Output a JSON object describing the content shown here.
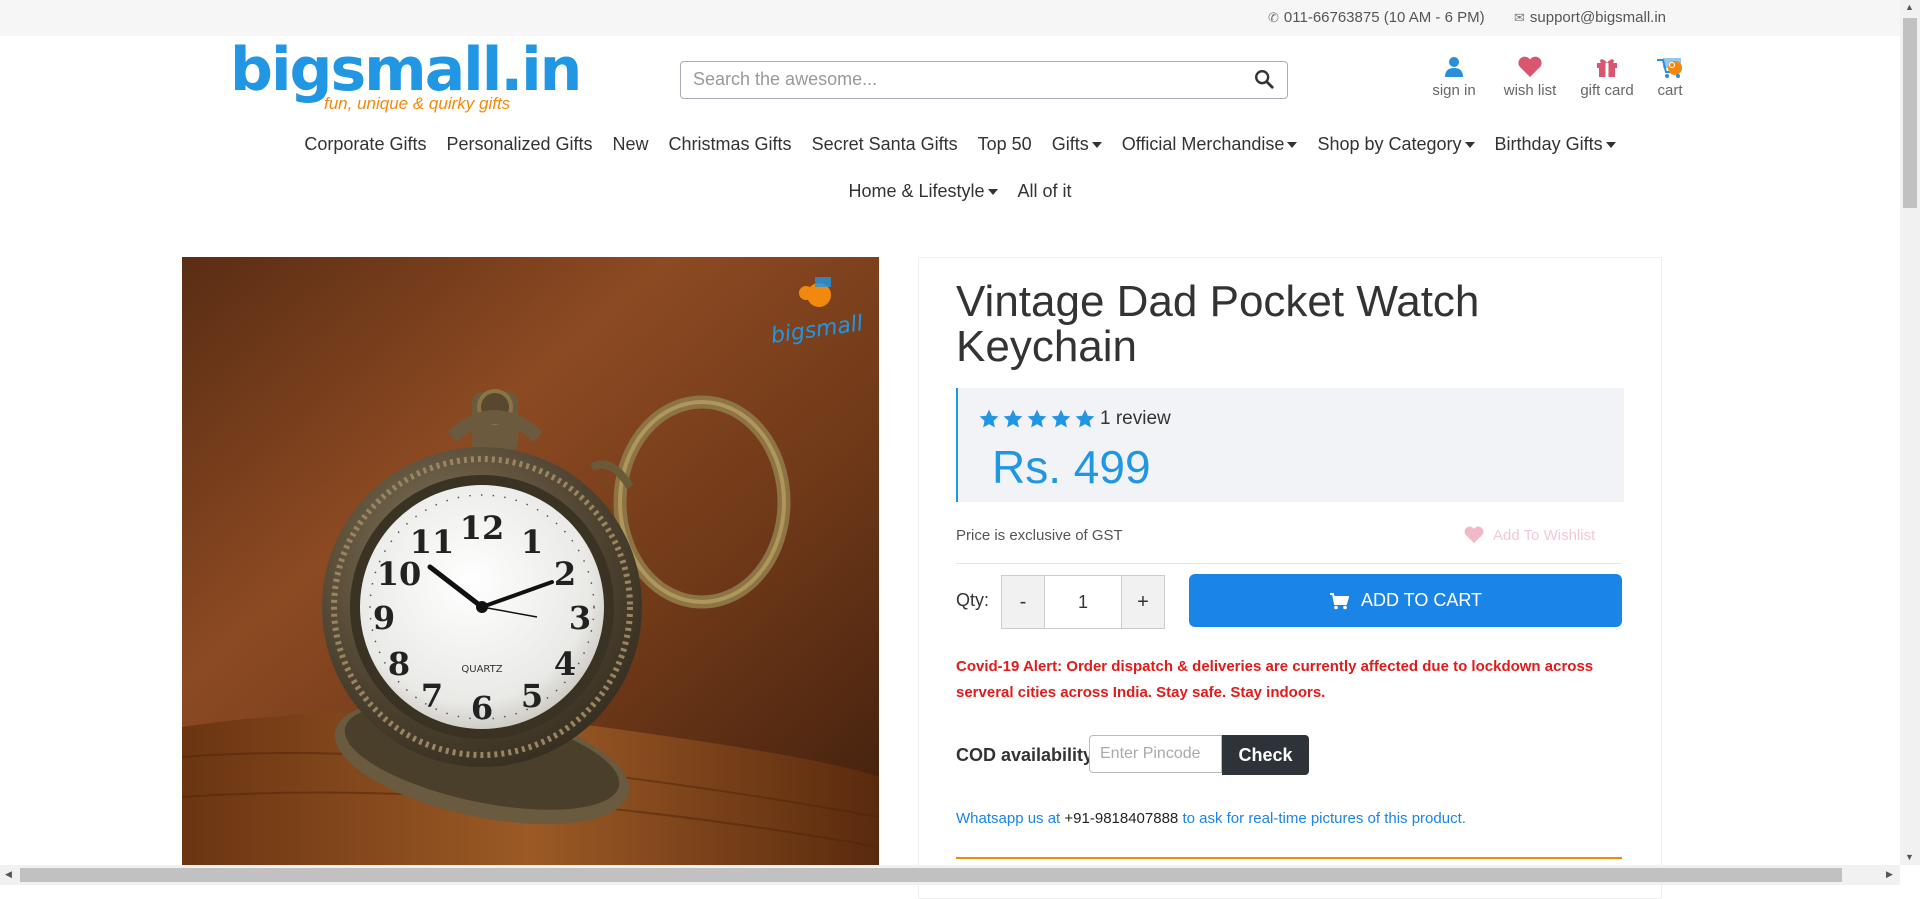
{
  "topbar": {
    "phone": "011-66763875 (10 AM - 6 PM)",
    "email": "support@bigsmall.in"
  },
  "logo": {
    "brand": "bigsmall.in",
    "tagline": "fun, unique & quirky gifts"
  },
  "search": {
    "placeholder": "Search the awesome..."
  },
  "header_icons": {
    "signin": "sign in",
    "wishlist": "wish list",
    "giftcard": "gift card",
    "cart": "cart"
  },
  "nav": {
    "row1": [
      {
        "label": "Corporate Gifts",
        "dropdown": false
      },
      {
        "label": "Personalized Gifts",
        "dropdown": false
      },
      {
        "label": "New",
        "dropdown": false
      },
      {
        "label": "Christmas Gifts",
        "dropdown": false
      },
      {
        "label": "Secret Santa Gifts",
        "dropdown": false
      },
      {
        "label": "Top 50",
        "dropdown": false
      },
      {
        "label": "Gifts",
        "dropdown": true
      },
      {
        "label": "Official Merchandise",
        "dropdown": true
      },
      {
        "label": "Shop by Category",
        "dropdown": true
      },
      {
        "label": "Birthday Gifts",
        "dropdown": true
      }
    ],
    "row2": [
      {
        "label": "Home & Lifestyle",
        "dropdown": true
      },
      {
        "label": "All of it",
        "dropdown": false
      }
    ]
  },
  "product": {
    "title": "Vintage Dad Pocket Watch Keychain",
    "rating": 5,
    "reviews": "1 review",
    "price": "Rs. 499",
    "gst_note": "Price is exclusive of GST",
    "wishlist_label": "Add To Wishlist",
    "qty_label": "Qty:",
    "qty_minus": "-",
    "qty_value": "1",
    "qty_plus": "+",
    "add_to_cart": "ADD TO CART",
    "alert": "Covid-19 Alert: Order dispatch & deliveries are currently affected due to lockdown across serveral cities across India. Stay safe. Stay indoors.",
    "cod_label": "COD availability",
    "pincode_placeholder": "Enter Pincode",
    "check_label": "Check",
    "whatsapp_prefix": "Whatsapp us at",
    "whatsapp_number": "+91-9818407888",
    "whatsapp_suffix": "to ask for real-time pictures of this product."
  },
  "product_image": {
    "watermark": "bigsmall",
    "dial_brand": "QUARTZ"
  },
  "colors": {
    "accent": "#1b84e7",
    "brand_blue": "#2196e3",
    "brand_orange": "#f2890f",
    "alert_red": "#e01b1b",
    "wishlist_pink": "#d9566f"
  }
}
